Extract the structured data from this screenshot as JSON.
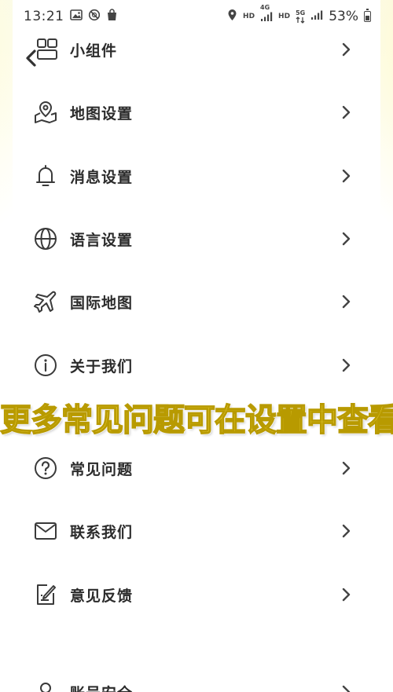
{
  "status_bar": {
    "time": "13:21",
    "hd1": "HD",
    "net1": "4G",
    "hd2": "HD",
    "net2": "5G",
    "battery_pct": "53%"
  },
  "menu": {
    "items": [
      {
        "label": "小组件",
        "icon": "widget-icon"
      },
      {
        "label": "地图设置",
        "icon": "map-pin-icon"
      },
      {
        "label": "消息设置",
        "icon": "bell-icon"
      },
      {
        "label": "语言设置",
        "icon": "globe-icon"
      },
      {
        "label": "国际地图",
        "icon": "plane-icon"
      },
      {
        "label": "关于我们",
        "icon": "info-icon"
      },
      {
        "label": "常见问题",
        "icon": "question-icon"
      },
      {
        "label": "联系我们",
        "icon": "mail-icon"
      },
      {
        "label": "意见反馈",
        "icon": "feedback-icon"
      },
      {
        "label": "账号安全",
        "icon": "account-icon"
      }
    ]
  },
  "overlay": {
    "caption": "更多常见问题可在设置中查看"
  },
  "colors": {
    "caption_fill": "#ffe64d",
    "caption_stroke": "#b89a00",
    "text": "#2b2b2b"
  }
}
